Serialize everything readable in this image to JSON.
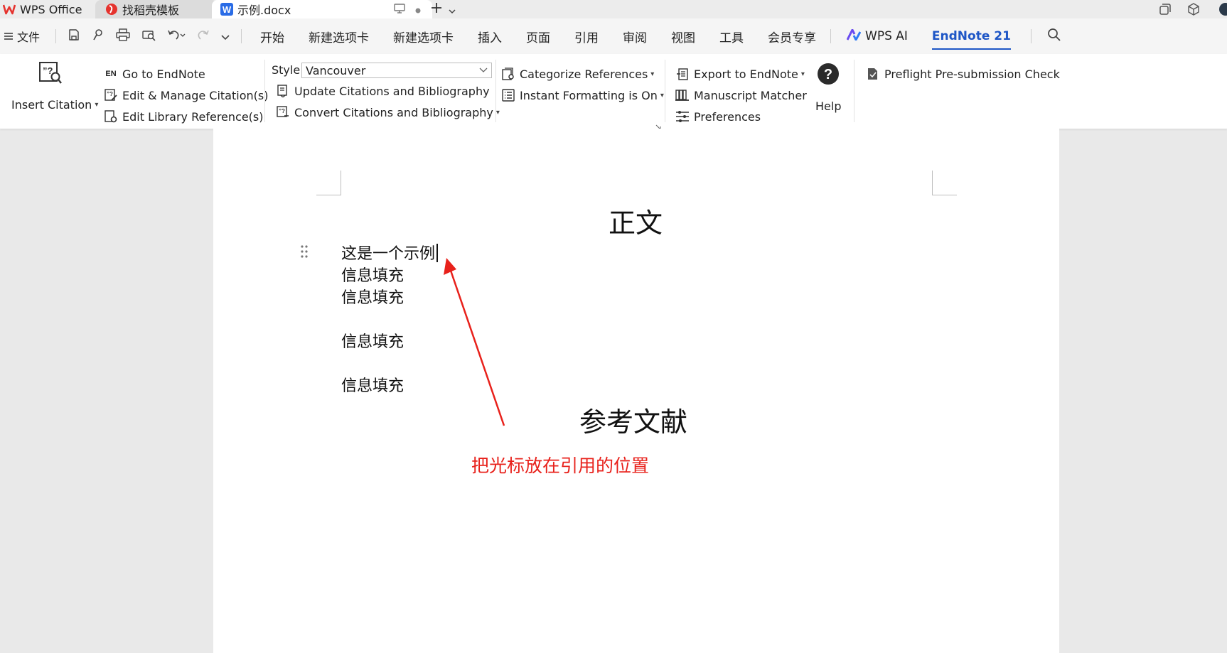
{
  "tabs": {
    "wps": "WPS Office",
    "template": "找稻壳模板",
    "document": "示例.docx"
  },
  "menu": {
    "file": "文件",
    "items": [
      "开始",
      "新建选项卡",
      "新建选项卡",
      "插入",
      "页面",
      "引用",
      "审阅",
      "视图",
      "工具",
      "会员专享"
    ],
    "wps_ai": "WPS AI",
    "endnote": "EndNote 21"
  },
  "ribbon": {
    "insert_citation": "Insert Citation",
    "go_to_endnote": "Go to EndNote",
    "en_badge": "EN",
    "edit_manage": "Edit & Manage Citation(s)",
    "edit_library": "Edit Library Reference(s)",
    "style_label": "Style:",
    "style_value": "Vancouver",
    "update_citations": "Update Citations and Bibliography",
    "convert_citations": "Convert Citations and Bibliography",
    "categorize": "Categorize References",
    "instant_formatting": "Instant Formatting is On",
    "export_endnote": "Export to EndNote",
    "manuscript_matcher": "Manuscript Matcher",
    "preferences": "Preferences",
    "help": "Help",
    "preflight": "Preflight Pre-submission Check"
  },
  "document": {
    "heading_main": "正文",
    "lines": [
      "这是一个示例",
      "信息填充",
      "信息填充",
      "信息填充",
      "信息填充"
    ],
    "heading_refs": "参考文献",
    "annotation": "把光标放在引用的位置"
  },
  "colors": {
    "accent": "#1e56c6",
    "annotation": "#e8211b",
    "wps_red": "#e5322d"
  }
}
